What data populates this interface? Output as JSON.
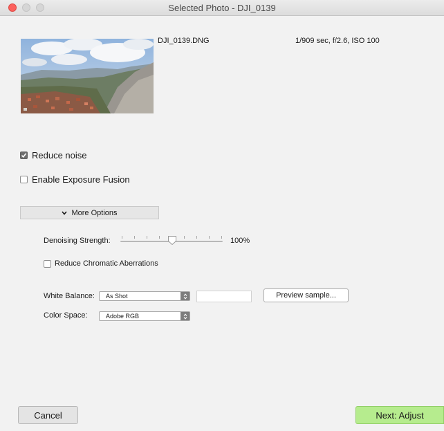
{
  "window": {
    "title": "Selected Photo - DJI_0139"
  },
  "photo": {
    "filename": "DJI_0139.DNG",
    "exif": "1/909 sec, f/2.6, ISO 100"
  },
  "options": {
    "reduce_noise": {
      "label": "Reduce noise",
      "checked": true
    },
    "exposure_fusion": {
      "label": "Enable Exposure Fusion",
      "checked": false
    },
    "more_options_label": "More Options"
  },
  "denoise": {
    "label": "Denoising Strength:",
    "value_text": "100%",
    "slider_fraction": 0.5
  },
  "chromatic": {
    "label": "Reduce Chromatic Aberrations",
    "checked": false
  },
  "white_balance": {
    "label": "White Balance:",
    "selected": "As Shot",
    "custom_value": ""
  },
  "color_space": {
    "label": "Color Space:",
    "selected": "Adobe RGB"
  },
  "buttons": {
    "preview": "Preview sample...",
    "cancel": "Cancel",
    "next": "Next: Adjust"
  },
  "colors": {
    "close_button": "#fc605c",
    "next_button": "#b6ec8e",
    "window_bg": "#f2f2f2"
  },
  "icons": [
    "close-icon",
    "minimize-icon",
    "zoom-icon",
    "checkmark-icon",
    "chevron-down-icon",
    "select-arrows-icon"
  ]
}
